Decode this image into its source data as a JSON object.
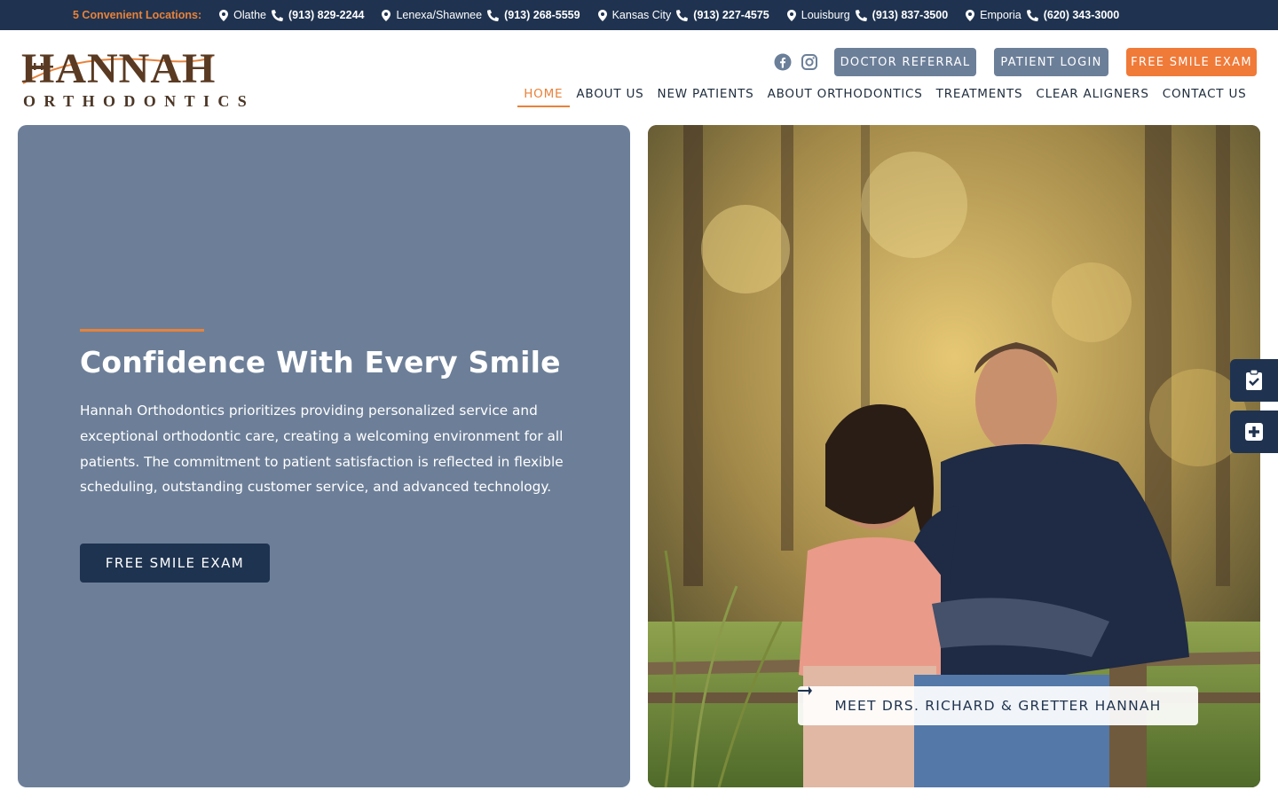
{
  "topbar": {
    "lead": "5 Convenient Locations:",
    "locations": [
      {
        "city": "Olathe",
        "phone": "(913) 829-2244"
      },
      {
        "city": "Lenexa/Shawnee",
        "phone": "(913) 268-5559"
      },
      {
        "city": "Kansas City",
        "phone": "(913) 227-4575"
      },
      {
        "city": "Louisburg",
        "phone": "(913) 837-3500"
      },
      {
        "city": "Emporia",
        "phone": "(620) 343-3000"
      }
    ]
  },
  "logo": {
    "main": "HANNAH",
    "sub": "ORTHODONTICS"
  },
  "header": {
    "social": [
      "facebook-icon",
      "instagram-icon"
    ],
    "buttons": {
      "referral": "DOCTOR REFERRAL",
      "login": "PATIENT LOGIN",
      "exam": "FREE SMILE EXAM"
    }
  },
  "nav": {
    "items": [
      {
        "label": "HOME"
      },
      {
        "label": "ABOUT US"
      },
      {
        "label": "NEW PATIENTS"
      },
      {
        "label": "ABOUT ORTHODONTICS"
      },
      {
        "label": "TREATMENTS"
      },
      {
        "label": "CLEAR ALIGNERS"
      },
      {
        "label": "CONTACT US"
      }
    ],
    "active": "HOME"
  },
  "hero": {
    "title": "Confidence With Every Smile",
    "text": "Hannah Orthodontics prioritizes providing personalized service and exceptional orthodontic care, creating a welcoming environment for all patients. The commitment to patient satisfaction is reflected in flexible scheduling, outstanding customer service, and advanced technology.",
    "button": "FREE SMILE EXAM",
    "meet_button": "MEET DRS. RICHARD & GRETTER HANNAH"
  },
  "side_widgets": [
    "clipboard-check-icon",
    "plus-square-icon"
  ],
  "colors": {
    "topbar": "#1f3350",
    "accent": "#e8823a",
    "panel": "#6d7f98",
    "header_button": "#6c7f99",
    "exam_button": "#f07a38",
    "logo": "#5a3a22"
  }
}
